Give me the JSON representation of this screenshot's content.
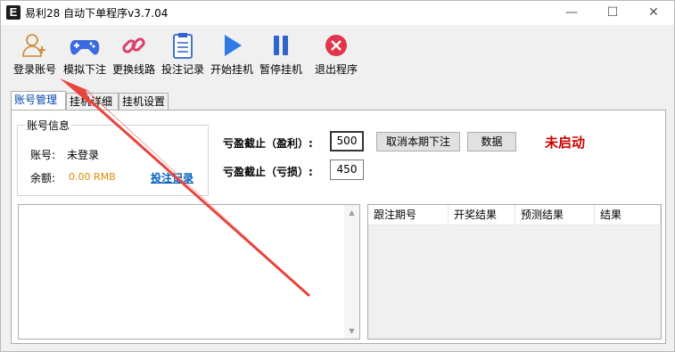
{
  "window": {
    "title": "易利28 自动下单程序v3.7.04",
    "app_icon_letter": "E",
    "controls": {
      "minimize": "—",
      "maximize": "☐",
      "close": "✕"
    }
  },
  "toolbar": [
    {
      "label": "登录账号",
      "icon": "user-add-icon"
    },
    {
      "label": "模拟下注",
      "icon": "gamepad-icon"
    },
    {
      "label": "更换线路",
      "icon": "link-icon"
    },
    {
      "label": "投注记录",
      "icon": "clipboard-icon"
    },
    {
      "label": "开始挂机",
      "icon": "play-icon"
    },
    {
      "label": "暂停挂机",
      "icon": "pause-icon"
    },
    {
      "label": "退出程序",
      "icon": "close-circle-icon"
    }
  ],
  "tabs": [
    "账号管理",
    "挂机详细",
    "挂机设置"
  ],
  "account": {
    "group_title": "账号信息",
    "account_label": "账号:",
    "account_value": "未登录",
    "balance_label": "余额:",
    "balance_value": "0.00 RMB",
    "bet_record_link": "投注记录"
  },
  "settings": {
    "profit_label": "亏盈截止（盈利）:",
    "profit_value": "500",
    "loss_label": "亏盈截止（亏损）:",
    "loss_value": "450",
    "cancel_button": "取消本期下注",
    "data_button": "数据",
    "status": "未启动"
  },
  "grid": {
    "columns": [
      "跟注期号",
      "开奖结果",
      "预测结果",
      "结果"
    ]
  },
  "colors": {
    "status": "#d00000",
    "arrow": "#e8453c",
    "link": "#0060c0"
  }
}
